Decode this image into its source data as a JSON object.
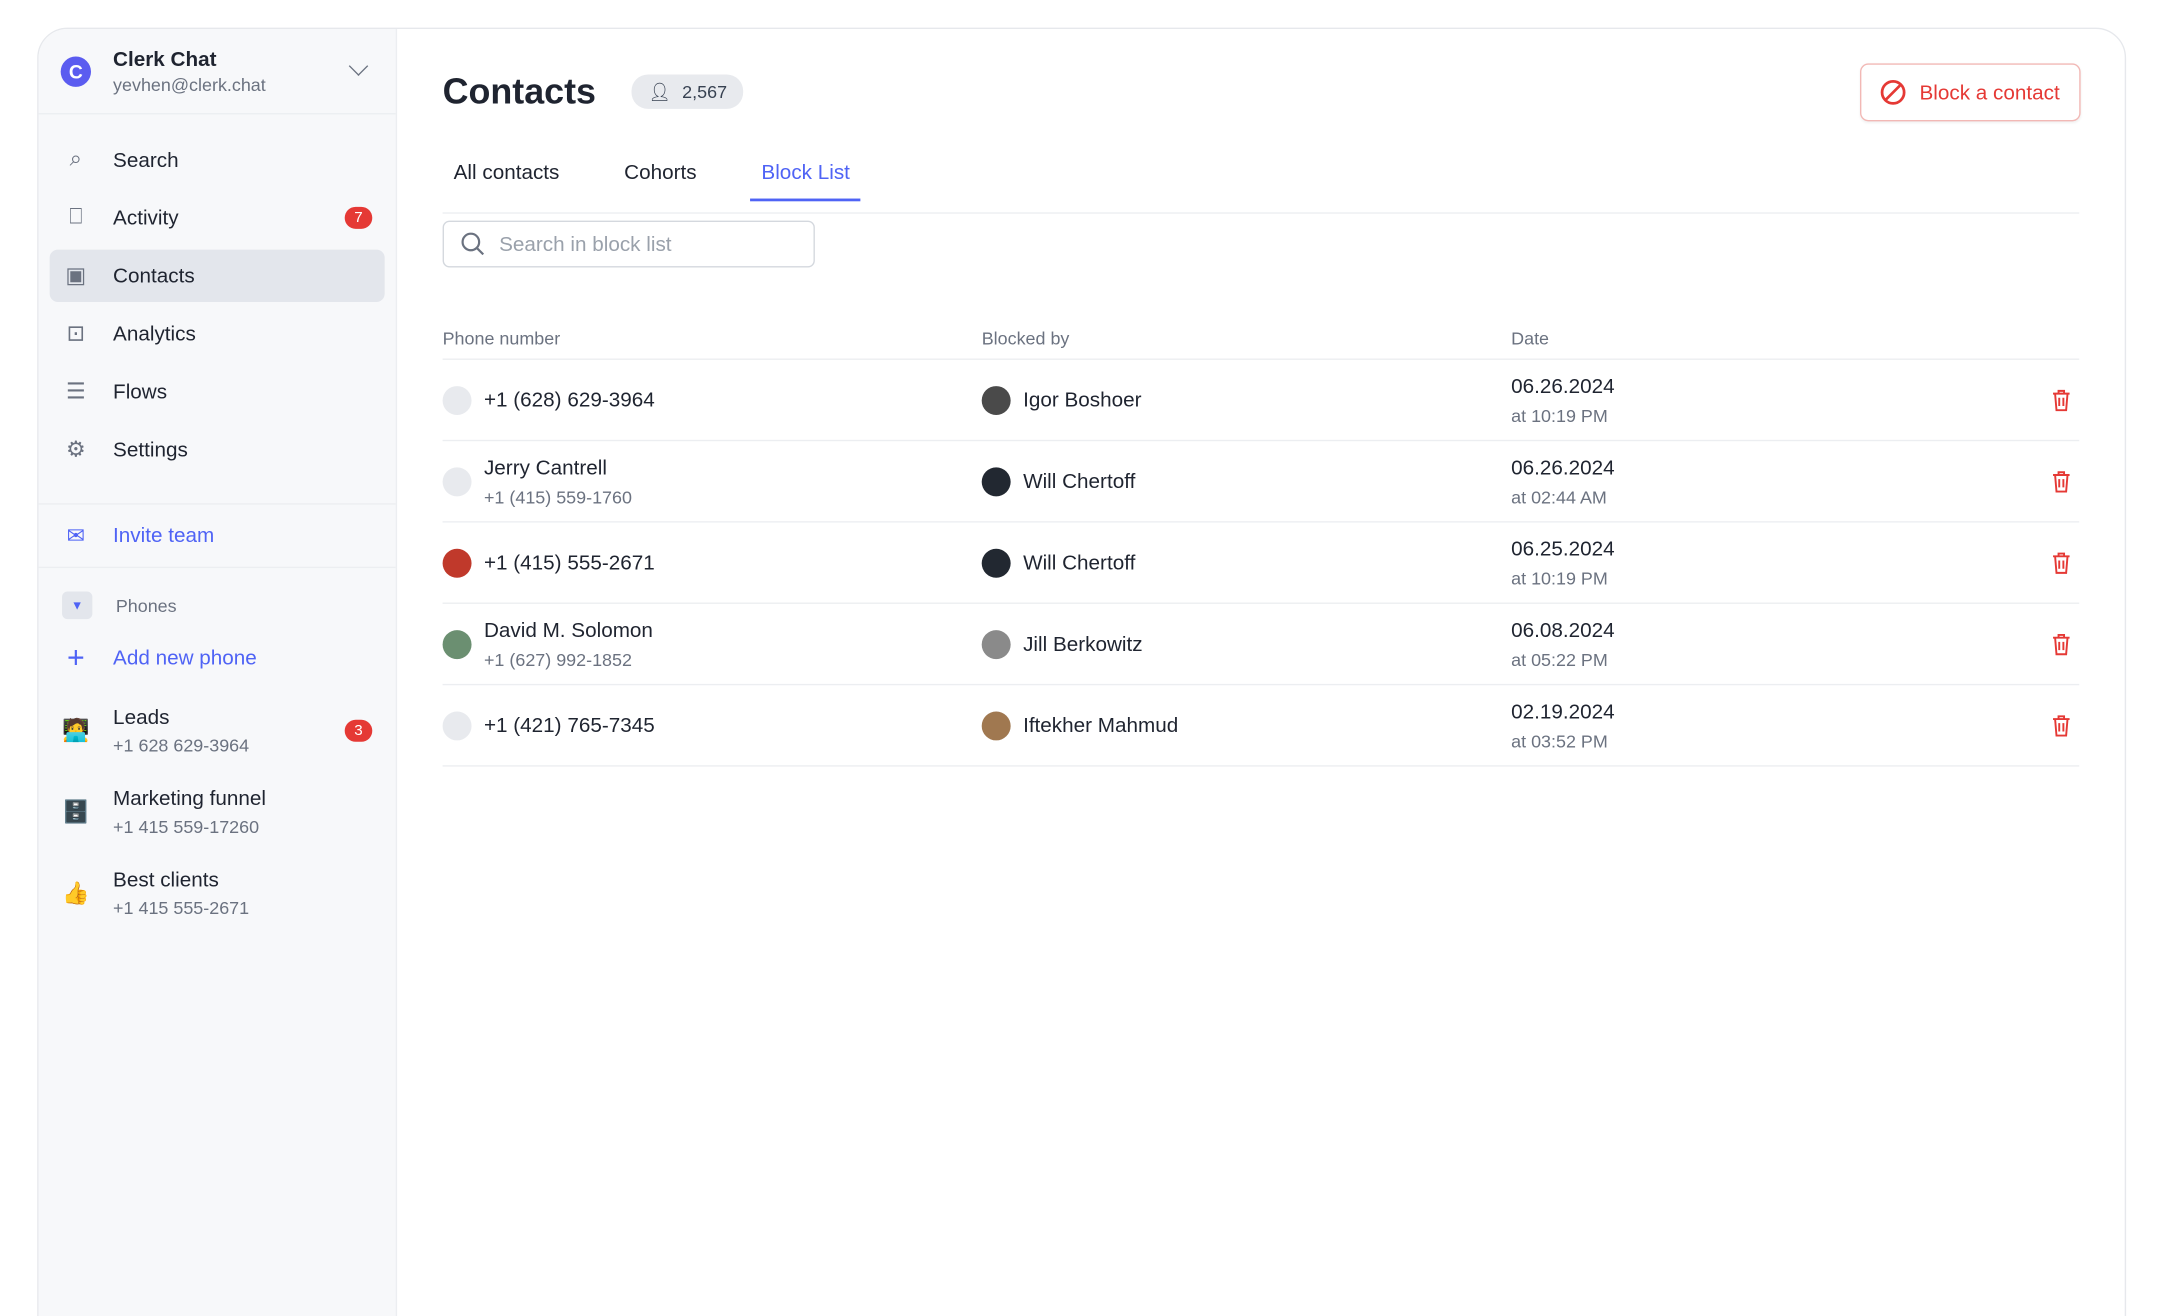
{
  "account": {
    "name": "Clerk Chat",
    "email": "yevhen@clerk.chat",
    "logo_letter": "C"
  },
  "nav": [
    {
      "label": "Search",
      "icon": "search-icon"
    },
    {
      "label": "Activity",
      "icon": "inbox-icon",
      "badge": "7"
    },
    {
      "label": "Contacts",
      "icon": "contact-card-icon",
      "active": true
    },
    {
      "label": "Analytics",
      "icon": "presentation-icon"
    },
    {
      "label": "Flows",
      "icon": "flows-icon"
    },
    {
      "label": "Settings",
      "icon": "gear-icon"
    }
  ],
  "invite": {
    "label": "Invite team",
    "icon": "mail-plus-icon"
  },
  "phones": {
    "header": "Phones",
    "add_label": "Add new phone",
    "items": [
      {
        "name": "Leads",
        "number": "+1 628 629-3964",
        "emoji": "🧑‍💻",
        "badge": "3"
      },
      {
        "name": "Marketing funnel",
        "number": "+1 415 559-17260",
        "emoji": "🗄️"
      },
      {
        "name": "Best clients",
        "number": "+1 415 555-2671",
        "emoji": "👍"
      }
    ]
  },
  "header": {
    "title": "Contacts",
    "count": "2,567",
    "block_button": "Block a contact"
  },
  "tabs": [
    {
      "label": "All contacts"
    },
    {
      "label": "Cohorts"
    },
    {
      "label": "Block List",
      "active": true
    }
  ],
  "search": {
    "placeholder": "Search in block list",
    "value": ""
  },
  "table": {
    "columns": [
      "Phone number",
      "Blocked by",
      "Date"
    ],
    "rows": [
      {
        "name": "+1 (628) 629-3964",
        "sub": "",
        "avatar": "#e8eaee",
        "blocked_by": "Igor Boshoer",
        "by_avatar": "#4a4a4a",
        "date": "06.26.2024",
        "time": "at 10:19 PM"
      },
      {
        "name": "Jerry Cantrell",
        "sub": "+1 (415) 559-1760",
        "avatar": "#e8eaee",
        "blocked_by": "Will Chertoff",
        "by_avatar": "#222831",
        "date": "06.26.2024",
        "time": "at 02:44 AM"
      },
      {
        "name": "+1 (415) 555-2671",
        "sub": "",
        "avatar": "#c0392b",
        "blocked_by": "Will Chertoff",
        "by_avatar": "#222831",
        "date": "06.25.2024",
        "time": "at 10:19 PM"
      },
      {
        "name": "David M. Solomon",
        "sub": "+1 (627) 992-1852",
        "avatar": "#6b8f71",
        "blocked_by": "Jill Berkowitz",
        "by_avatar": "#8a8a8a",
        "date": "06.08.2024",
        "time": "at 05:22 PM"
      },
      {
        "name": "+1 (421) 765-7345",
        "sub": "",
        "avatar": "#e8eaee",
        "blocked_by": "Iftekher Mahmud",
        "by_avatar": "#a07850",
        "date": "02.19.2024",
        "time": "at 03:52 PM"
      }
    ]
  },
  "colors": {
    "accent": "#4f63f5",
    "danger": "#e53935",
    "sidebar_bg": "#f7f8fa"
  }
}
